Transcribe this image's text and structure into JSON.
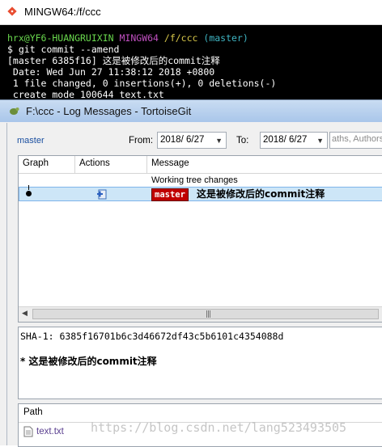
{
  "terminal": {
    "title": "MINGW64:/f/ccc",
    "prompt_user": "hrx@YF6-HUANGRUIXIN",
    "prompt_env": "MINGW64",
    "prompt_path": "/f/ccc",
    "prompt_branch": "(master)",
    "command": "$ git commit --amend",
    "output": [
      "[master 6385f16] 这是被修改后的commit注释",
      " Date: Wed Jun 27 11:38:12 2018 +0800",
      " 1 file changed, 0 insertions(+), 0 deletions(-)",
      " create mode 100644 text.txt"
    ]
  },
  "tortoise": {
    "title": "F:\\ccc - Log Messages - TortoiseGit",
    "branch": "master",
    "from_label": "From:",
    "from_value": "2018/ 6/27",
    "to_label": "To:",
    "to_value": "2018/ 6/27",
    "search_placeholder": "aths, Authors",
    "columns": {
      "graph": "Graph",
      "actions": "Actions",
      "message": "Message"
    },
    "rows": [
      {
        "message": "Working tree changes"
      },
      {
        "tag": "master",
        "message": "这是被修改后的commit注释"
      }
    ],
    "sha_line": "SHA-1: 6385f16701b6c3d46672df43c5b6101c4354088d",
    "commit_message": "* 这是被修改后的commit注释",
    "path_header": "Path",
    "files": [
      "text.txt"
    ],
    "scroll_grip": "|||"
  },
  "watermark": "https://blog.csdn.net/lang523493505",
  "colors": {
    "terminal_bg": "#000000",
    "prompt_green": "#6ad94e",
    "tag_red": "#c00000",
    "selection": "#cde6f7"
  }
}
